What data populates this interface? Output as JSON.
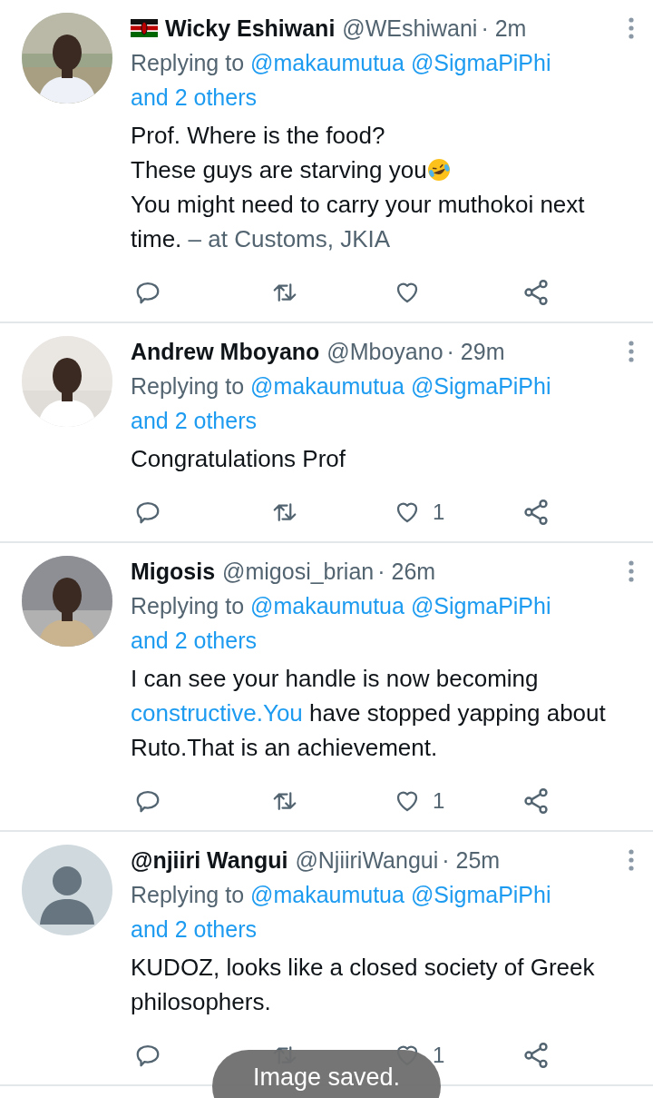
{
  "tweets": [
    {
      "avatar": {
        "kind": "picture"
      },
      "flag": true,
      "name": "Wicky Eshiwani",
      "handle": "@WEshiwani",
      "time": "· 2m",
      "replying_label": "Replying to",
      "mentions": [
        "@makaumutua",
        "@SigmaPiPhi"
      ],
      "others": "and 2 others",
      "body": [
        {
          "kind": "text",
          "text": "Prof. Where is the food?\nThese guys are starving you"
        },
        {
          "kind": "emoji"
        },
        {
          "kind": "text",
          "text": "\nYou might need to carry your muthokoi next time. "
        },
        {
          "kind": "place",
          "text": "– at Customs, JKIA"
        }
      ]
    },
    {
      "avatar": {
        "kind": "picture"
      },
      "flag": false,
      "name": "Andrew Mboyano",
      "handle": "@Mboyano",
      "time": "· 29m",
      "replying_label": "Replying to",
      "mentions": [
        "@makaumutua",
        "@SigmaPiPhi"
      ],
      "others": "and 2 others",
      "body": [
        {
          "kind": "text",
          "text": "Congratulations Prof"
        }
      ],
      "likes": "1"
    },
    {
      "avatar": {
        "kind": "picture"
      },
      "flag": false,
      "name": "Migosis",
      "handle": "@migosi_brian",
      "time": "· 26m",
      "replying_label": "Replying to",
      "mentions": [
        "@makaumutua",
        "@SigmaPiPhi"
      ],
      "others": "and 2 others",
      "body": [
        {
          "kind": "text",
          "text": "I can see your handle is now becoming "
        },
        {
          "kind": "link",
          "text": "constructive.You"
        },
        {
          "kind": "text",
          "text": " have stopped yapping about Ruto.That is an achievement."
        }
      ],
      "likes": "1"
    },
    {
      "avatar": {
        "kind": "default"
      },
      "flag": false,
      "name": "@njiiri Wangui",
      "handle": "@NjiiriWangui",
      "time": "· 25m",
      "replying_label": "Replying to",
      "mentions": [
        "@makaumutua",
        "@SigmaPiPhi"
      ],
      "others": "and 2 others",
      "body": [
        {
          "kind": "text",
          "text": "KUDOZ, looks like a closed society of Greek philosophers."
        }
      ],
      "likes": "1"
    }
  ],
  "toast": {
    "text": "Image saved."
  }
}
